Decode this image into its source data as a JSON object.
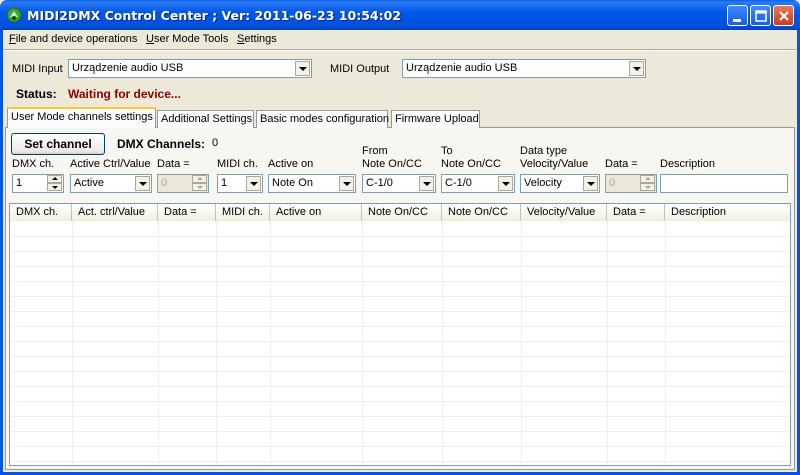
{
  "window": {
    "title": "MIDI2DMX Control Center ; Ver: 2011-06-23 10:54:02"
  },
  "menu": {
    "items": [
      {
        "ul": "F",
        "rest": "ile and device operations"
      },
      {
        "ul": "U",
        "rest": "ser Mode Tools"
      },
      {
        "ul": "S",
        "rest": "ettings"
      }
    ]
  },
  "midi": {
    "input_label": "MIDI Input",
    "input_value": "Urządzenie audio USB",
    "output_label": "MIDI Output",
    "output_value": "Urządzenie audio USB"
  },
  "status": {
    "label": "Status:",
    "value": "Waiting for device..."
  },
  "tabs": [
    {
      "label": "User Mode channels settings",
      "active": true
    },
    {
      "label": "Additional Settings",
      "active": false
    },
    {
      "label": "Basic modes configuration",
      "active": false
    },
    {
      "label": "Firmware Upload",
      "active": false
    }
  ],
  "controls": {
    "set_channel_label": "Set channel",
    "dmx_channels_label": "DMX Channels:",
    "dmx_channels_value": "0",
    "dmx_ch_label": "DMX ch.",
    "dmx_ch_value": "1",
    "active_ctrl_label": "Active Ctrl/Value",
    "active_ctrl_value": "Active",
    "data1_label": "Data =",
    "data1_value": "0",
    "midi_ch_label": "MIDI ch.",
    "midi_ch_value": "1",
    "active_on_label": "Active on",
    "active_on_value": "Note On",
    "from_label_1": "From",
    "from_label_2": "Note On/CC",
    "from_value": "C-1/0",
    "to_label_1": "To",
    "to_label_2": "Note On/CC",
    "to_value": "C-1/0",
    "data_type_label_1": "Data type",
    "data_type_label_2": "Velocity/Value",
    "data_type_value": "Velocity",
    "data2_label": "Data =",
    "data2_value": "0",
    "description_label": "Description",
    "description_value": ""
  },
  "table": {
    "columns": [
      "DMX ch.",
      "Act. ctrl/Value",
      "Data =",
      "MIDI ch.",
      "Active on",
      "Note On/CC",
      "Note On/CC",
      "Velocity/Value",
      "Data =",
      "Description"
    ]
  },
  "colors": {
    "status_text": "#8B0000",
    "title_bar": "#0058E8",
    "tab_highlight": "#FFC83C"
  }
}
